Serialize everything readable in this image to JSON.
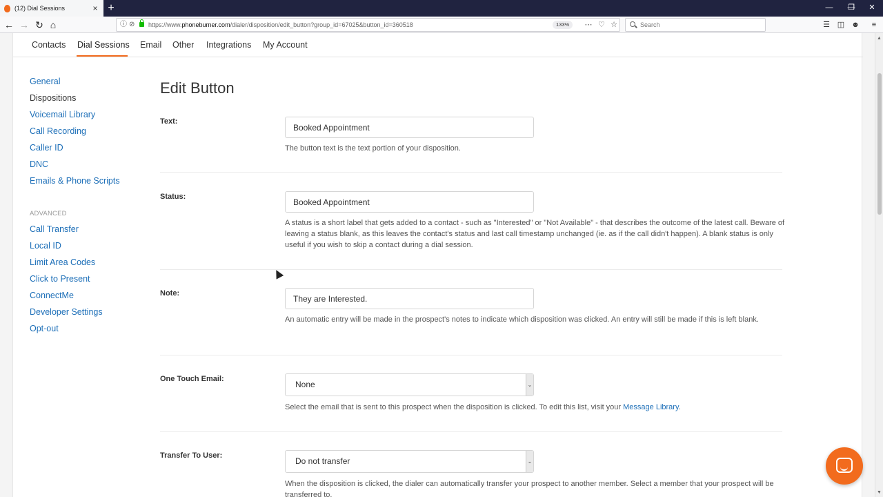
{
  "browser": {
    "tab_title": "(12) Dial Sessions",
    "tab_close": "×",
    "new_tab": "+",
    "url_prefix": "https://www.",
    "url_domain": "phoneburner.com",
    "url_path": "/dialer/disposition/edit_button?group_id=67025&button_id=360518",
    "zoom": "133%",
    "search_placeholder": "Search",
    "window_controls": [
      "—",
      "❐",
      "✕"
    ]
  },
  "topnav": {
    "items": [
      "Contacts",
      "Dial Sessions",
      "Email",
      "Other",
      "Integrations",
      "My Account"
    ],
    "active": "Dial Sessions"
  },
  "sidebar": {
    "items": [
      "General",
      "Dispositions",
      "Voicemail Library",
      "Call Recording",
      "Caller ID",
      "DNC",
      "Emails & Phone Scripts"
    ],
    "advanced_label": "ADVANCED",
    "advanced_items": [
      "Call Transfer",
      "Local ID",
      "Limit Area Codes",
      "Click to Present",
      "ConnectMe",
      "Developer Settings",
      "Opt-out"
    ]
  },
  "form": {
    "heading": "Edit Button",
    "text": {
      "label": "Text:",
      "value": "Booked Appointment",
      "help": "The button text is the text portion of your disposition."
    },
    "status": {
      "label": "Status:",
      "value": "Booked Appointment",
      "help": "A status is a short label that gets added to a contact - such as \"Interested\" or \"Not Available\" - that describes the outcome of the latest call. Beware of leaving a status blank, as this leaves the contact's status and last call timestamp unchanged (ie. as if the call didn't happen). A blank status is only useful if you wish to skip a contact during a dial session."
    },
    "note": {
      "label": "Note:",
      "value": "They are Interested.",
      "help": "An automatic entry will be made in the prospect's notes to indicate which disposition was clicked. An entry will still be made if this is left blank."
    },
    "one_touch_email": {
      "label": "One Touch Email:",
      "value": "None",
      "help_before": "Select the email that is sent to this prospect when the disposition is clicked. To edit this list, visit your ",
      "help_link": "Message Library",
      "help_after": "."
    },
    "transfer_to_user": {
      "label": "Transfer To User:",
      "value": "Do not transfer",
      "help": "When the disposition is clicked, the dialer can automatically transfer your prospect to another member. Select a member that your prospect will be transferred to."
    }
  },
  "colors": {
    "accent": "#f26b1d",
    "link": "#1d6fb8",
    "tabbar": "#202340"
  }
}
